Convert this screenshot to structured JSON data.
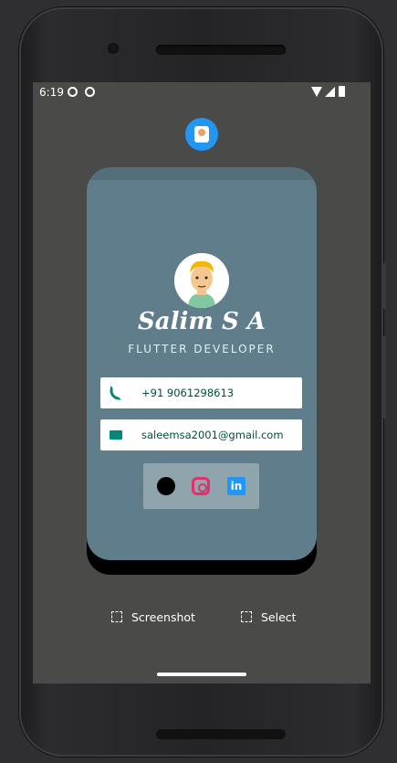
{
  "status_bar": {
    "time": "6:19"
  },
  "overlay": {
    "bubble_icon": "profile-badge-icon"
  },
  "profile": {
    "name": "Salim S A",
    "title": "FLUTTER DEVELOPER",
    "phone": "+91 9061298613",
    "email": "saleemsa2001@gmail.com"
  },
  "social": [
    {
      "icon": "github-icon"
    },
    {
      "icon": "instagram-icon"
    },
    {
      "icon": "linkedin-icon",
      "glyph": "in"
    }
  ],
  "bottom_actions": {
    "screenshot_label": "Screenshot",
    "select_label": "Select"
  },
  "colors": {
    "card_bg": "#607d8b",
    "card_appbar": "#546e7a",
    "accent": "#00897b",
    "bubble": "#2196f3"
  }
}
